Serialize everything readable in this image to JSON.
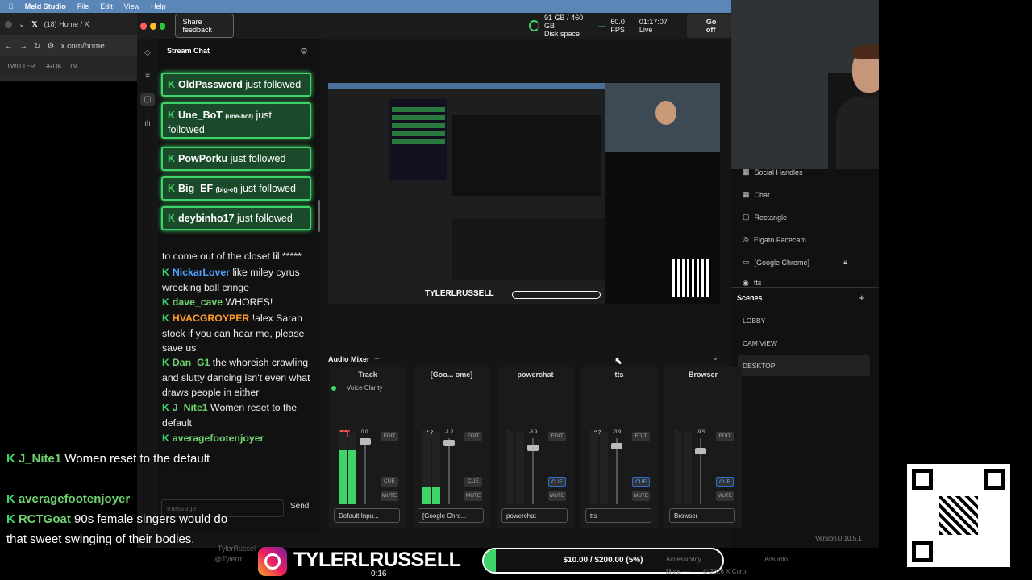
{
  "menubar": {
    "app": "Meld Studio",
    "items": [
      "File",
      "Edit",
      "View",
      "Help"
    ]
  },
  "browser": {
    "tab_label": "(18) Home / X",
    "url": "x.com/home",
    "bookmarks": [
      "TWITTER",
      "GROK",
      "IN"
    ]
  },
  "meld": {
    "feedback_label": "Share feedback",
    "disk": "91 GB / 460 GB",
    "disk_label": "Disk space",
    "fps": "60.0",
    "fps_label": "FPS",
    "time": "01:17:07",
    "time_label": "Live",
    "go_offline": "Go off",
    "version": "Version 0.10.5.1"
  },
  "chat": {
    "title": "Stream Chat",
    "follows": [
      {
        "name": "OldPassword",
        "suffix": "just followed"
      },
      {
        "name": "Une_BoT",
        "tag": "(une-bot)",
        "suffix": "just followed"
      },
      {
        "name": "PowPorku",
        "suffix": "just followed"
      },
      {
        "name": "Big_EF",
        "tag": "(big-ef)",
        "suffix": "just followed"
      },
      {
        "name": "deybinho17",
        "suffix": "just followed"
      }
    ],
    "messages": [
      {
        "user": "",
        "text": "to come out of the closet lil *****"
      },
      {
        "user": "NickarLover",
        "color": "#4fa3ff",
        "text": " like miley cyrus wrecking ball cringe"
      },
      {
        "user": "dave_cave",
        "color": "#6fd46f",
        "text": " WHORES!"
      },
      {
        "user": "HVACGROYPER",
        "color": "#ff9a2e",
        "text": " !alex Sarah stock if you can hear me, please save us"
      },
      {
        "user": "Dan_G1",
        "color": "#6fd46f",
        "text": " the whoreish crawling and slutty dancing isn't even what draws people in either"
      },
      {
        "user": "J_Nite1",
        "color": "#6fd46f",
        "text": " Women reset to the default"
      },
      {
        "user": "averagefootenjoyer",
        "color": "#6fd46f",
        "text": ""
      },
      {
        "user": "RCTGoat",
        "color": "#6fd46f",
        "text": " 90s female singers would do that sweet swinging of their bodies."
      }
    ],
    "input_placeholder": "message",
    "send_label": "Send"
  },
  "sources": [
    "Social Handles",
    "Chat",
    "Rectangle",
    "Elgato Facecam",
    "[Google Chrome]",
    "tts"
  ],
  "scenes": {
    "title": "Scenes",
    "items": [
      "LOBBY",
      "CAM VIEW",
      "DESKTOP"
    ]
  },
  "mixer": {
    "title": "Audio Mixer",
    "channels": [
      {
        "name": "Track",
        "db1": "0.0",
        "db2": "0.0",
        "source": "Default Inpu...",
        "effect": "Voice Clarity"
      },
      {
        "name": "[Goo... ome]",
        "db1": "-1.3",
        "db2": "-1.2",
        "source": "[Google Chro..."
      },
      {
        "name": "powerchat",
        "db1": "",
        "db2": "-6.9",
        "source": "powerchat"
      },
      {
        "name": "tts",
        "db1": "-8.7",
        "db2": "-3.9",
        "source": "tts"
      },
      {
        "name": "Browser",
        "db1": "",
        "db2": "-9.5",
        "source": "Browser"
      }
    ],
    "edit": "EDIT",
    "cue": "CUE",
    "mute": "MUTE"
  },
  "overlay": {
    "lines": [
      {
        "user": "J_Nite1",
        "text": " Women reset to the default"
      },
      {
        "user": "averagefootenjoyer",
        "text": ""
      },
      {
        "user": "RCTGoat",
        "text": " 90s female singers would do that sweet swinging of their bodies."
      }
    ],
    "handle": "TYLERLRUSSELL",
    "goal": "$10.00 / $200.00 (5%)",
    "goal_progress": 0.05,
    "video_time": "0:16",
    "footer_links": [
      "Accessibility",
      "Ads info",
      "More ···",
      "© 2026 X Corp."
    ],
    "profile": "TylerRussel",
    "profile_handle": "@Tylerrr"
  }
}
